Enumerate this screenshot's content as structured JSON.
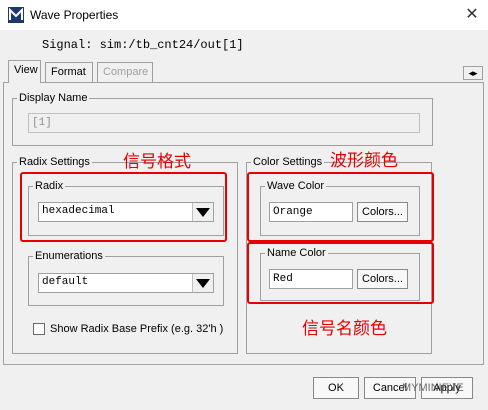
{
  "window": {
    "title": "Wave Properties",
    "close_glyph": "✕"
  },
  "signal_text": "Signal: sim:/tb_cnt24/out[1]",
  "tabs": [
    {
      "label": "View",
      "active": true
    },
    {
      "label": "Format",
      "active": false
    },
    {
      "label": "Compare",
      "active": false,
      "disabled": true
    }
  ],
  "tab_scroll_glyph": "◂▸",
  "display_name": {
    "legend": "Display Name",
    "value": "[1]"
  },
  "radix_settings": {
    "legend": "Radix Settings",
    "radix": {
      "legend": "Radix",
      "selected": "hexadecimal"
    },
    "enumerations": {
      "legend": "Enumerations",
      "selected": "default"
    },
    "show_prefix_label": "Show Radix Base Prefix (e.g. 32'h )"
  },
  "color_settings": {
    "legend": "Color Settings",
    "wave_color": {
      "legend": "Wave Color",
      "value": "Orange",
      "button": "Colors..."
    },
    "name_color": {
      "legend": "Name Color",
      "value": "Red",
      "button": "Colors..."
    }
  },
  "annotations": {
    "signal_format": "信号格式",
    "waveform_color": "波形颜色",
    "signal_name_color": "信号名颜色"
  },
  "footer": {
    "ok": "OK",
    "cancel": "Cancel",
    "apply": "Apply"
  },
  "watermark": "MYMINIEYE",
  "colors": {
    "annotation_red": "#e60000"
  }
}
